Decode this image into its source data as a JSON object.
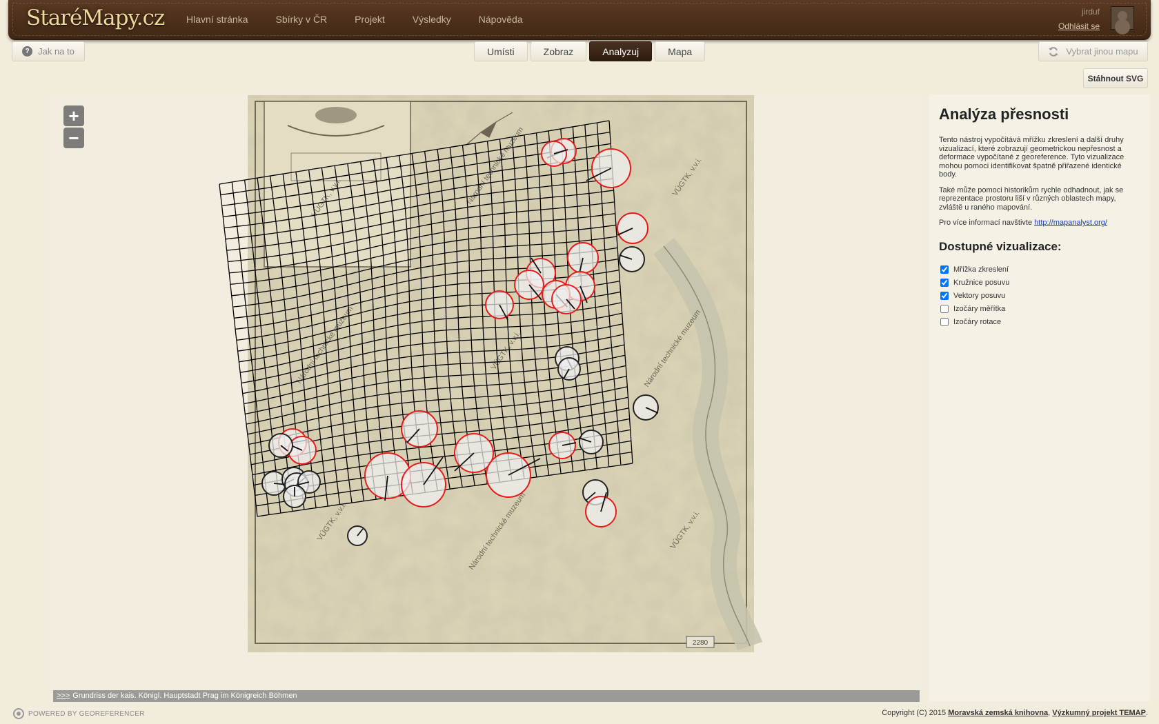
{
  "header": {
    "logo": "StaréMapy.cz",
    "nav": [
      "Hlavní stránka",
      "Sbírky v ČR",
      "Projekt",
      "Výsledky",
      "Nápověda"
    ],
    "username": "jirduf",
    "logout": "Odhlásit se"
  },
  "toolbar": {
    "help": "Jak na to",
    "tabs": [
      "Umísti",
      "Zobraz",
      "Analyzuj",
      "Mapa"
    ],
    "active_tab": "Analyzuj",
    "switch_map": "Vybrat jinou mapu",
    "download_svg": "Stáhnout SVG"
  },
  "map": {
    "caption_link": ">>>",
    "caption": "Grundriss der kais. Königl. Hauptstadt Prag im Königreich Böhmen",
    "watermarks": [
      "VÚGTK, v.v.i.",
      "Národní technické muzeum"
    ],
    "map_number": "2280",
    "colors": {
      "grid": "#000000",
      "error_circle": "#e61c1c",
      "ok_circle": "#222222"
    }
  },
  "panel": {
    "title": "Analýza přesnosti",
    "para1": "Tento nástroj vypočítává mřížku zkreslení a další druhy vizualizací, které zobrazují geometrickou nepřesnost a deformace vypočítané z georeference. Tyto vizualizace mohou pomoci identifikovat špatně přiřazené identické body.",
    "para2": "Také může pomoci historikům rychle odhadnout, jak se reprezentace prostoru liší v různých oblastech mapy, zvláště u raného mapování.",
    "more_prefix": "Pro více informací navštivte ",
    "more_link": "http://mapanalyst.org/",
    "vis_title": "Dostupné vizualizace:",
    "options": [
      {
        "label": "Mřížka zkreslení",
        "checked": true
      },
      {
        "label": "Kružnice posuvu",
        "checked": true
      },
      {
        "label": "Vektory posuvu",
        "checked": true
      },
      {
        "label": "Izočáry měřítka",
        "checked": false
      },
      {
        "label": "Izočáry rotace",
        "checked": false
      }
    ]
  },
  "footer": {
    "powered": "POWERED BY GEOREFERENCER",
    "copyright_prefix": "Copyright (C) 2015 ",
    "org1": "Moravská zemská knihovna",
    "sep": ", ",
    "org2": "Výzkumný projekt TEMAP",
    "suffix": "."
  }
}
